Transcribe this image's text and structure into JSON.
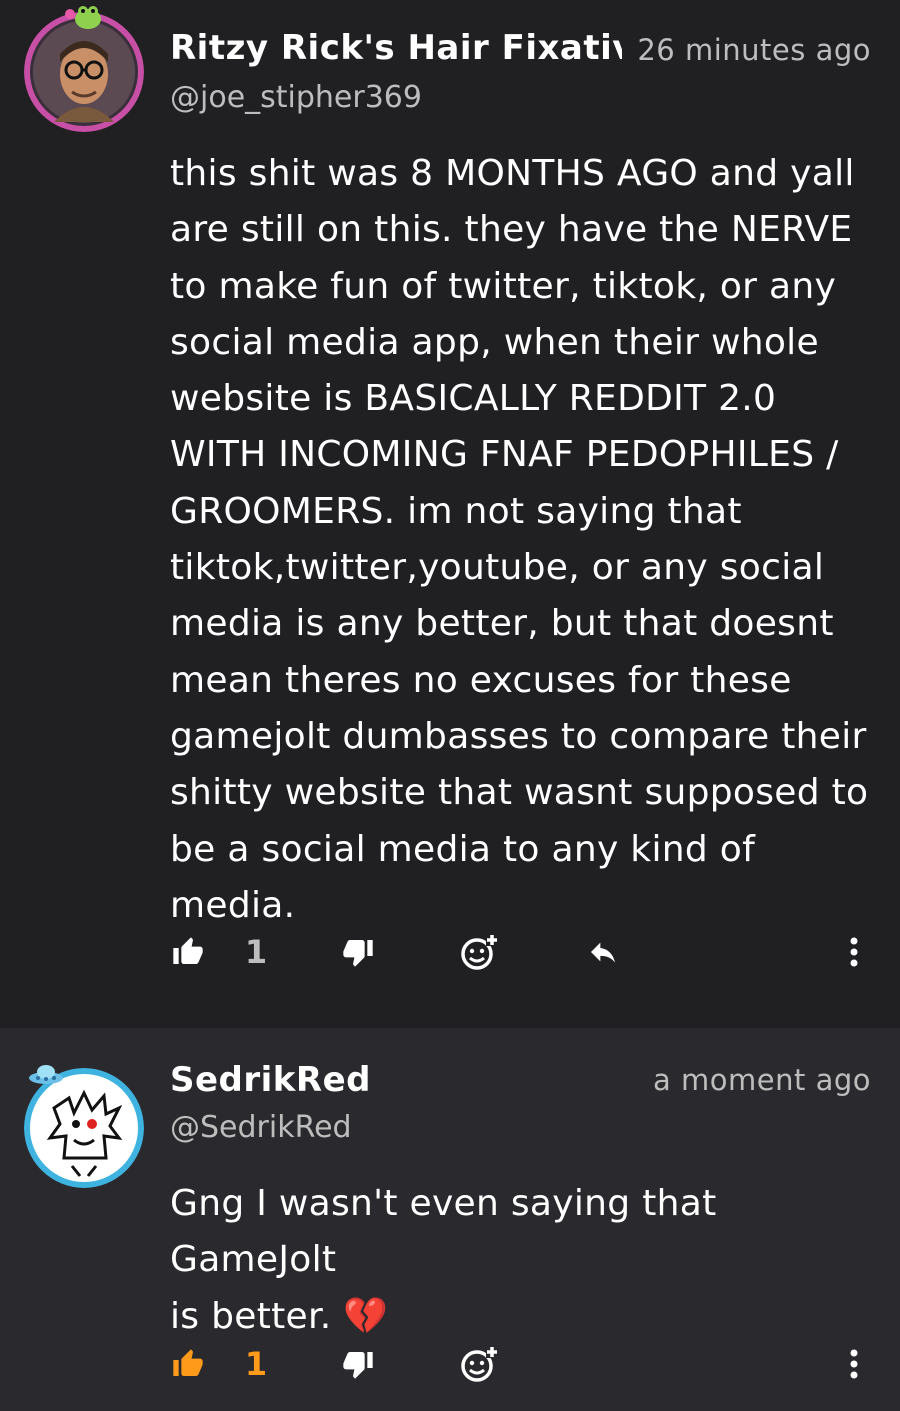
{
  "comments": [
    {
      "display_name": "Ritzy Rick's Hair Fixative",
      "handle": "@joe_stipher369",
      "time": "26 minutes ago",
      "lines": [
        "this shit was 8 MONTHS AGO and yall",
        "are still on this. they have the NERVE",
        "to make fun of twitter, tiktok, or any",
        "social media app, when their whole",
        "website is BASICALLY REDDIT 2.0",
        "WITH INCOMING FNAF PEDOPHILES /",
        "GROOMERS. im not saying that",
        "tiktok,twitter,youtube, or any social",
        "media is any better, but that doesnt",
        "mean theres no excuses for these",
        "gamejolt dumbasses to compare their",
        "shitty website that wasnt supposed to",
        "be a social media to any kind of media."
      ],
      "like_count": "1",
      "liked": false,
      "avatar_ring_color": "#c84fa6"
    },
    {
      "display_name": "SedrikRed",
      "handle": "@SedrikRed",
      "time": "a moment ago",
      "lines": [
        "Gng I wasn't even saying that GameJolt",
        "is better. 💔"
      ],
      "like_count": "1",
      "liked": true,
      "avatar_ring_color": "#3fb3e0"
    }
  ],
  "colors": {
    "background": "#201f22",
    "reply_background": "#2a292d",
    "text": "#ffffff",
    "muted": "#bdbdbd",
    "icon": "#ffffff",
    "liked_accent": "#ff9a1a"
  },
  "icons": {
    "like": "thumbs-up-icon",
    "dislike": "thumbs-down-icon",
    "reaction": "add-reaction-icon",
    "reply": "reply-icon",
    "more": "more-vertical-icon"
  }
}
